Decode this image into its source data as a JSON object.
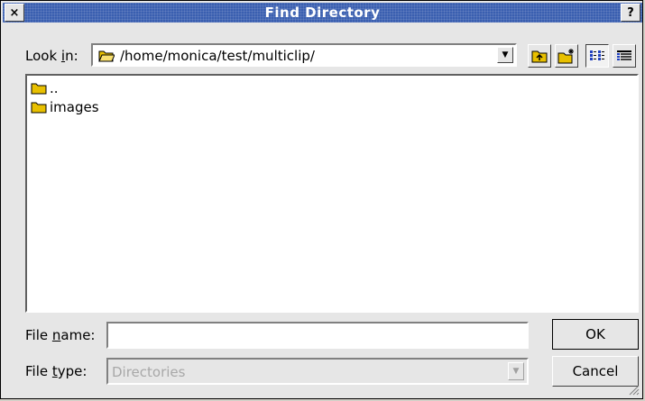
{
  "window": {
    "title": "Find Directory",
    "close_label": "×",
    "help_label": "?"
  },
  "look_in": {
    "label": "Look in:",
    "mnemonic_char": "i",
    "path": "/home/monica/test/multiclip/"
  },
  "toolbar": {
    "icons": [
      "parent-directory-icon",
      "new-folder-icon",
      "list-view-icon",
      "detail-view-icon"
    ]
  },
  "files": {
    "items": [
      {
        "name": "..",
        "icon": "folder-icon"
      },
      {
        "name": "images",
        "icon": "folder-icon"
      }
    ]
  },
  "file_name": {
    "label": "File name:",
    "value": "",
    "placeholder": ""
  },
  "file_type": {
    "label": "File type:",
    "value": "Directories"
  },
  "buttons": {
    "ok": "OK",
    "cancel": "Cancel"
  },
  "colors": {
    "titlebar": "#3a5fb0",
    "folder": "#e8c000",
    "disabled_text": "#a8a8a8"
  }
}
